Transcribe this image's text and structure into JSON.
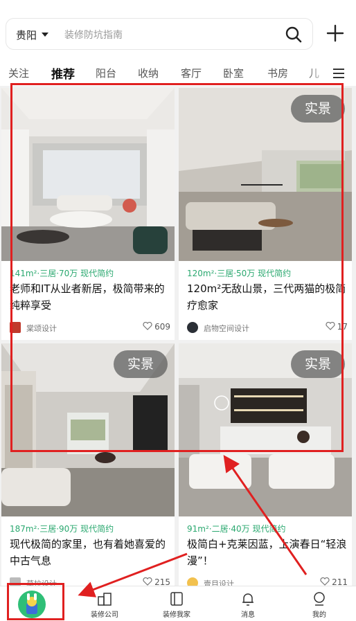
{
  "header": {
    "city": "贵阳",
    "search_placeholder": "装修防坑指南"
  },
  "tabs": [
    {
      "label": "关注"
    },
    {
      "label": "推荐",
      "active": true
    },
    {
      "label": "阳台"
    },
    {
      "label": "收纳"
    },
    {
      "label": "客厅"
    },
    {
      "label": "卧室"
    },
    {
      "label": "书房"
    },
    {
      "label": "儿"
    }
  ],
  "cards": [
    {
      "badge": "",
      "meta": "141m²·三居·70万 现代简约",
      "title": "老师和IT从业者新居，极简带来的纯粹享受",
      "author": "棠颂设计",
      "likes": "609"
    },
    {
      "badge": "实景",
      "meta": "120m²·三居·50万 现代简约",
      "title": "120m²无敌山景，三代两猫的极简疗愈家",
      "author": "启物空间设计",
      "likes": "17"
    },
    {
      "badge": "实景",
      "meta": "187m²·三居·90万 现代简约",
      "title": "现代极简的家里，也有着她喜爱的中古气息",
      "author": "草拉设计",
      "likes": "215"
    },
    {
      "badge": "实景",
      "meta": "91m²·二居·40万 现代简约",
      "title": "极简白+克莱因蓝，上演春日“轻浪漫”！",
      "author": "壹目设计",
      "likes": "211"
    }
  ],
  "bottom_nav": [
    {
      "label": "",
      "icon": "home-logo-icon"
    },
    {
      "label": "装修公司",
      "icon": "company-icon"
    },
    {
      "label": "装修我家",
      "icon": "book-icon"
    },
    {
      "label": "消息",
      "icon": "bell-icon"
    },
    {
      "label": "我的",
      "icon": "profile-icon"
    }
  ],
  "colors": {
    "accent_green": "#2aa86f",
    "annotation_red": "#e02020"
  }
}
